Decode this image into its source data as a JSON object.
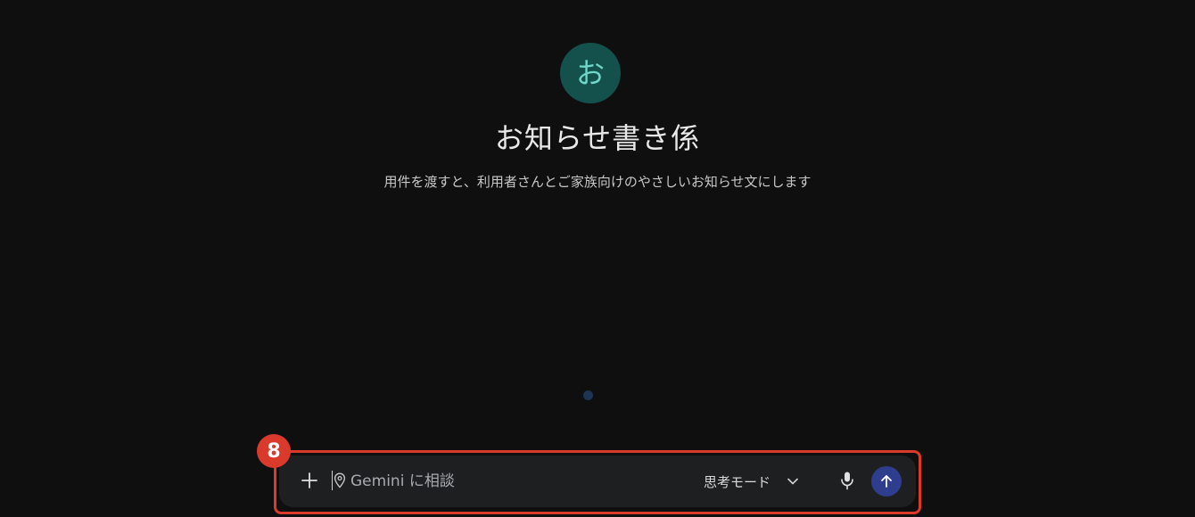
{
  "gem": {
    "avatar_letter": "お",
    "title": "お知らせ書き係",
    "description": "用件を渡すと、利用者さんとご家族向けのやさしいお知らせ文にします"
  },
  "annotation": {
    "step_number": "8"
  },
  "composer": {
    "placeholder": "Gemini に相談",
    "value": "",
    "mode_label": "思考モード",
    "icons": {
      "add": "plus-icon",
      "location": "location-pin-icon",
      "mode_dropdown": "chevron-down-icon",
      "voice": "microphone-icon",
      "send": "arrow-up-icon"
    }
  },
  "colors": {
    "background": "#0f0f10",
    "avatar_bg": "#14514d",
    "avatar_fg": "#6fd6c9",
    "highlight": "#d93a2b",
    "send_button": "#2f3d8f",
    "composer_bg": "#1e1f21"
  }
}
